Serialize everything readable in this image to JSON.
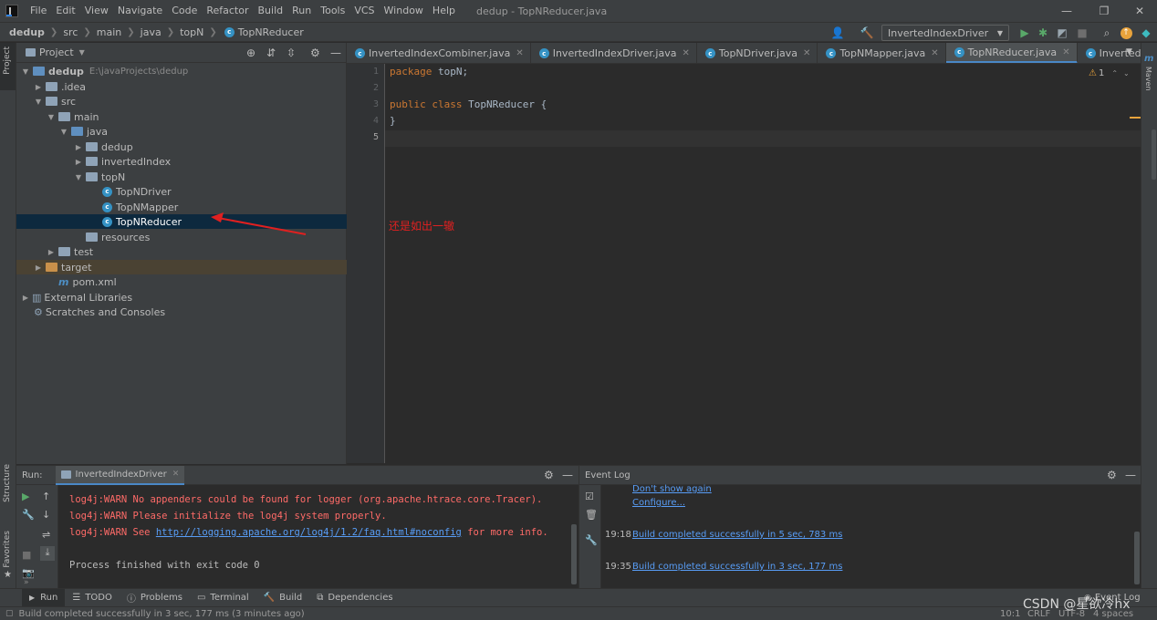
{
  "menubar": {
    "items": [
      "File",
      "Edit",
      "View",
      "Navigate",
      "Code",
      "Refactor",
      "Build",
      "Run",
      "Tools",
      "VCS",
      "Window",
      "Help"
    ],
    "window_title": "dedup - TopNReducer.java"
  },
  "breadcrumb": [
    "dedup",
    "src",
    "main",
    "java",
    "topN",
    "TopNReducer"
  ],
  "run_config": "InvertedIndexDriver",
  "project_panel": {
    "title": "Project",
    "tree": [
      {
        "label": "dedup",
        "path": "E:\\javaProjects\\dedup"
      },
      {
        "label": ".idea"
      },
      {
        "label": "src"
      },
      {
        "label": "main"
      },
      {
        "label": "java"
      },
      {
        "label": "dedup"
      },
      {
        "label": "invertedIndex"
      },
      {
        "label": "topN"
      },
      {
        "label": "TopNDriver"
      },
      {
        "label": "TopNMapper"
      },
      {
        "label": "TopNReducer"
      },
      {
        "label": "resources"
      },
      {
        "label": "test"
      },
      {
        "label": "target"
      },
      {
        "label": "pom.xml"
      },
      {
        "label": "External Libraries"
      },
      {
        "label": "Scratches and Consoles"
      }
    ]
  },
  "editor": {
    "tabs": [
      "InvertedIndexCombiner.java",
      "InvertedIndexDriver.java",
      "TopNDriver.java",
      "TopNMapper.java",
      "TopNReducer.java",
      "InvertedIndexMapper.j"
    ],
    "line_numbers": [
      "1",
      "2",
      "3",
      "4",
      "5"
    ],
    "code": {
      "l1_kw": "package",
      "l1_rest": " topN;",
      "l3_kw": "public class",
      "l3_rest": " TopNReducer {",
      "l4": "}"
    },
    "warning_count": "1",
    "annotation": "还是如出一辙"
  },
  "left_stripe": {
    "project": "Project",
    "structure": "Structure",
    "favorites": "Favorites"
  },
  "right_stripe": {
    "maven": "Maven"
  },
  "run_panel": {
    "label": "Run:",
    "tab": "InvertedIndexDriver",
    "logs": {
      "w1": "log4j:WARN No appenders could be found for logger (org.apache.htrace.core.Tracer).",
      "w2": "log4j:WARN Please initialize the log4j system properly.",
      "w3_pre": "log4j:WARN See ",
      "w3_link": "http://logging.apache.org/log4j/1.2/faq.html#noconfig",
      "w3_post": " for more info.",
      "exit": "Process finished with exit code 0"
    }
  },
  "event_log": {
    "title": "Event Log",
    "dont_show": "Don't show again",
    "configure": "Configure...",
    "entries": [
      {
        "time": "19:18",
        "text": "Build completed successfully in 5 sec, 783 ms"
      },
      {
        "time": "19:35",
        "text": "Build completed successfully in 3 sec, 177 ms"
      }
    ]
  },
  "tool_strip": [
    "Run",
    "TODO",
    "Problems",
    "Terminal",
    "Build",
    "Dependencies"
  ],
  "tool_strip_right": "Event Log",
  "status_bar": {
    "message": "Build completed successfully in 3 sec, 177 ms (3 minutes ago)",
    "position": "10:1",
    "line_sep": "CRLF",
    "encoding": "UTF-8",
    "indent": "4 spaces",
    "watermark": "CSDN @星欲冷hx"
  },
  "colors": {
    "accent": "#4a88c7",
    "selection": "#0d293e",
    "error": "#ff6b68",
    "link": "#589df6",
    "annotation": "#e02020"
  }
}
